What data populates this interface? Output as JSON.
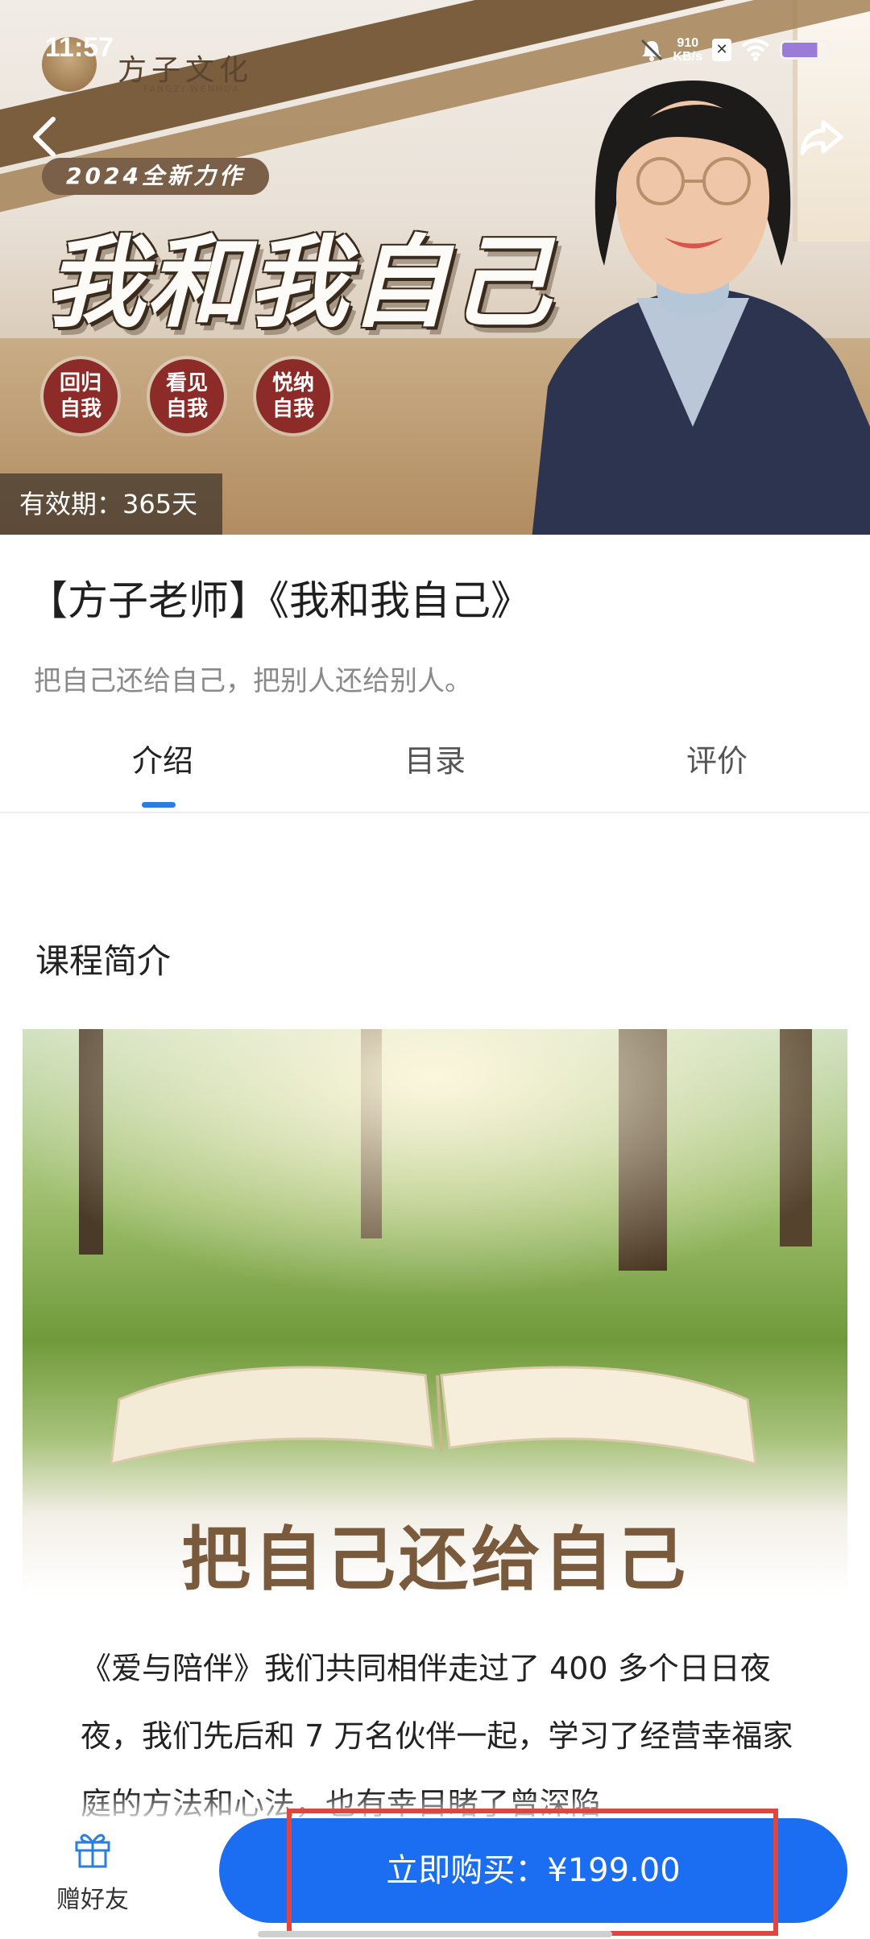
{
  "status_bar": {
    "time": "11:57",
    "net_speed_value": "910",
    "net_speed_unit": "KB/s",
    "battery_level": 0.75,
    "icons": [
      "bell-muted-icon",
      "app-x-icon",
      "wifi-icon",
      "battery-icon"
    ]
  },
  "hero": {
    "brand_text": "方子文化",
    "brand_sub": "FANGZI WENHUA",
    "badge": "2024全新力作",
    "title": "我和我自己",
    "tags": [
      "回归\n自我",
      "看见\n自我",
      "悦纳\n自我"
    ],
    "validity": "有效期：365天"
  },
  "course": {
    "title": "【方子老师】《我和我自己》",
    "subtitle": "把自己还给自己，把别人还给别人。"
  },
  "tabs": [
    {
      "label": "介绍",
      "active": true
    },
    {
      "label": "目录",
      "active": false
    },
    {
      "label": "评价",
      "active": false
    }
  ],
  "intro": {
    "section_title": "课程简介",
    "image_caption": "把自己还给自己",
    "text": "《爱与陪伴》我们共同相伴走过了 400 多个日日夜夜，我们先后和 7 万名伙伴一起，学习了经营幸福家庭的方法和心法，也有幸目睹了曾深陷"
  },
  "bottom_bar": {
    "gift_label": "赠好友",
    "buy_label": "立即购买：¥199.00"
  },
  "colors": {
    "accent": "#1b6df2",
    "tab_indicator": "#2a7de1",
    "tag_red": "#8d2b28",
    "highlight": "#e0453f"
  }
}
